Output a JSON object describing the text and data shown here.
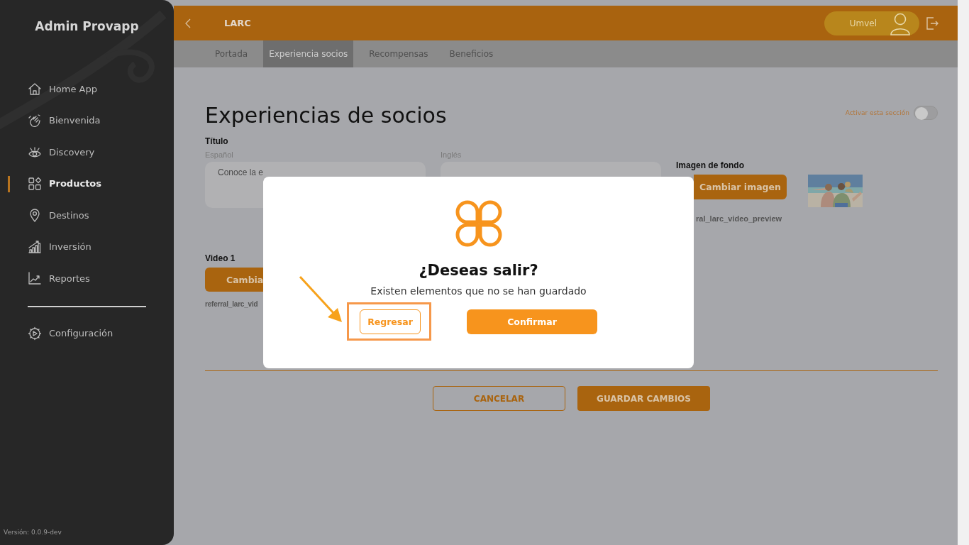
{
  "sidebar": {
    "title": "Admin Provapp",
    "items": [
      {
        "label": "Home App",
        "selected": false
      },
      {
        "label": "Bienvenida",
        "selected": false
      },
      {
        "label": "Discovery",
        "selected": false
      },
      {
        "label": "Productos",
        "selected": true
      },
      {
        "label": "Destinos",
        "selected": false
      },
      {
        "label": "Inversión",
        "selected": false
      },
      {
        "label": "Reportes",
        "selected": false
      }
    ],
    "footer_items": [
      {
        "label": "Configuración",
        "selected": false
      }
    ],
    "version": "Versión: 0.0.9-dev"
  },
  "header": {
    "title": "LARC",
    "user": "Umvel"
  },
  "tabs": [
    {
      "label": "Portada",
      "selected": false
    },
    {
      "label": "Experiencia socios",
      "selected": true
    },
    {
      "label": "Recompensas",
      "selected": false
    },
    {
      "label": "Beneficios",
      "selected": false
    }
  ],
  "page": {
    "heading": "Experiencias de socios",
    "toggle": {
      "label": "Activar esta sección",
      "on": false
    },
    "title_field": {
      "label": "Título",
      "spanish": {
        "label": "Español",
        "value": "Conoce la e"
      },
      "english": {
        "label": "Inglés"
      }
    },
    "background_image": {
      "label": "Imagen de fondo",
      "button": "Cambiar imagen",
      "filename": "ral_larc_video_preview"
    },
    "video": {
      "label": "Video 1",
      "button": "Cambia",
      "filename": "referral_larc_vid"
    },
    "buttons": [
      {
        "label": "CANCELAR",
        "kind": "outline"
      },
      {
        "label": "GUARDAR CAMBIOS",
        "kind": "filled"
      }
    ]
  },
  "dialog": {
    "title": "¿Deseas salir?",
    "message": "Existen elementos que no se han guardado",
    "buttons": [
      {
        "label": "Regresar",
        "kind": "outline",
        "highlighted": true
      },
      {
        "label": "Confirmar",
        "kind": "filled",
        "highlighted": false
      }
    ]
  }
}
